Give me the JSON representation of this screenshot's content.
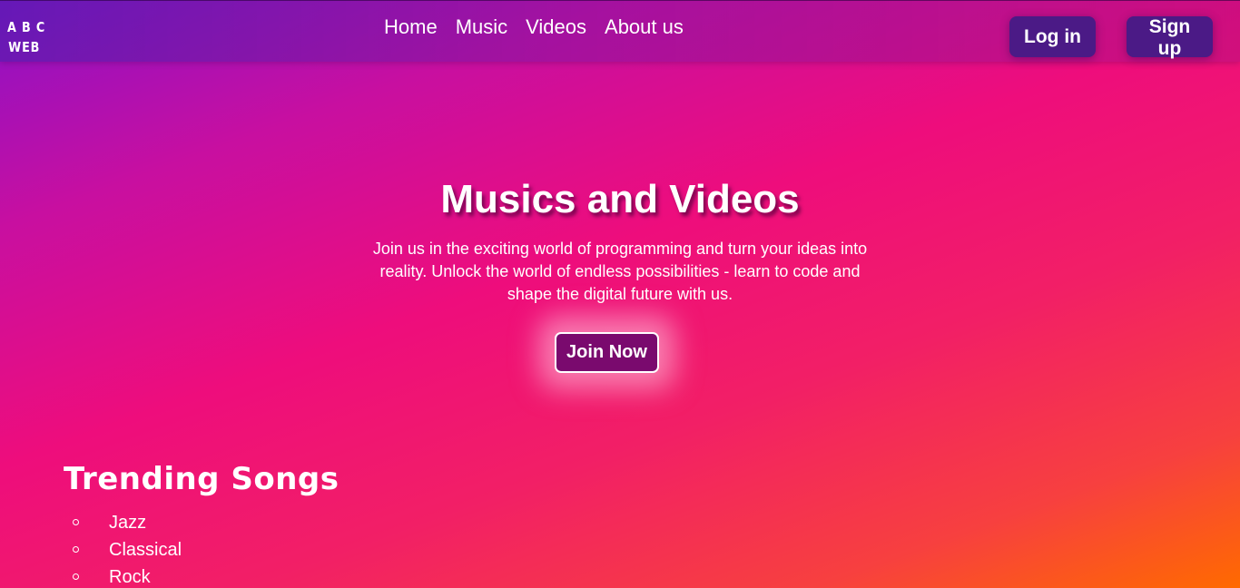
{
  "logo": {
    "line1": "A B C",
    "line2": "WEB"
  },
  "nav": {
    "items": [
      {
        "label": "Home"
      },
      {
        "label": "Music"
      },
      {
        "label": "Videos"
      },
      {
        "label": "About us"
      }
    ]
  },
  "auth": {
    "login_label": "Log in",
    "signup_label": "Sign up"
  },
  "hero": {
    "title": "Musics and Videos",
    "text": "Join us in the exciting world of programming and turn your ideas into reality. Unlock the world of endless possibilities - learn to code and shape the digital future with us.",
    "cta_label": "Join Now"
  },
  "trending": {
    "title": "Trending Songs",
    "items": [
      {
        "label": "Jazz"
      },
      {
        "label": "Classical"
      },
      {
        "label": "Rock"
      }
    ]
  },
  "colors": {
    "auth_button": "#4b1a86",
    "cta_button": "#7a0a6e",
    "gradient_start": "#8a12c8",
    "gradient_mid": "#ee0d7c",
    "gradient_end": "#ff6a00"
  }
}
